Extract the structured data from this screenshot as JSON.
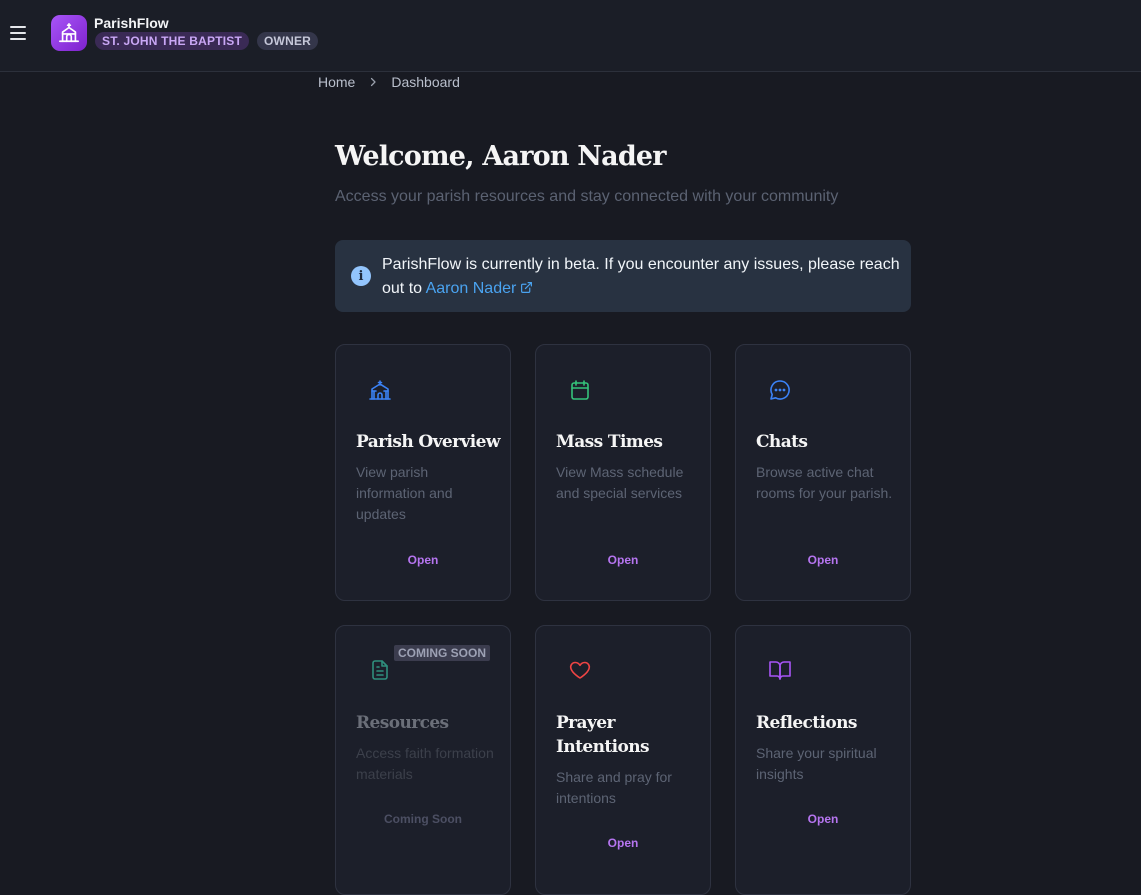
{
  "header": {
    "app_name": "ParishFlow",
    "parish_badge": "ST. JOHN THE BAPTIST",
    "role_badge": "OWNER"
  },
  "breadcrumb": {
    "home": "Home",
    "current": "Dashboard"
  },
  "main": {
    "welcome": "Welcome, Aaron Nader",
    "subtitle": "Access your parish resources and stay connected with your community"
  },
  "alert": {
    "text": "ParishFlow is currently in beta. If you encounter any issues, please reach out to",
    "link_text": "Aaron Nader"
  },
  "cards": [
    {
      "title": "Parish Overview",
      "description": "View parish information and updates",
      "action": "Open",
      "icon": "church-icon",
      "icon_color": "#3b82f6"
    },
    {
      "title": "Mass Times",
      "description": "View Mass schedule and special services",
      "action": "Open",
      "icon": "calendar-icon",
      "icon_color": "#34c37a"
    },
    {
      "title": "Chats",
      "description": "Browse active chat rooms for your parish.",
      "action": "Open",
      "icon": "chat-bubble-icon",
      "icon_color": "#3b82f6"
    },
    {
      "title": "Resources",
      "description": "Access faith formation materials",
      "action": "Coming Soon",
      "badge": "COMING SOON",
      "icon": "document-icon",
      "icon_color": "#2f8f7d"
    },
    {
      "title": "Prayer Intentions",
      "description": "Share and pray for intentions",
      "action": "Open",
      "icon": "heart-icon",
      "icon_color": "#ef4444"
    },
    {
      "title": "Reflections",
      "description": "Share your spiritual insights",
      "action": "Open",
      "icon": "book-icon",
      "icon_color": "#a855f7"
    }
  ],
  "colors": {
    "background": "#181a22",
    "accent": "#a855f7",
    "link": "#4aa3f0"
  }
}
